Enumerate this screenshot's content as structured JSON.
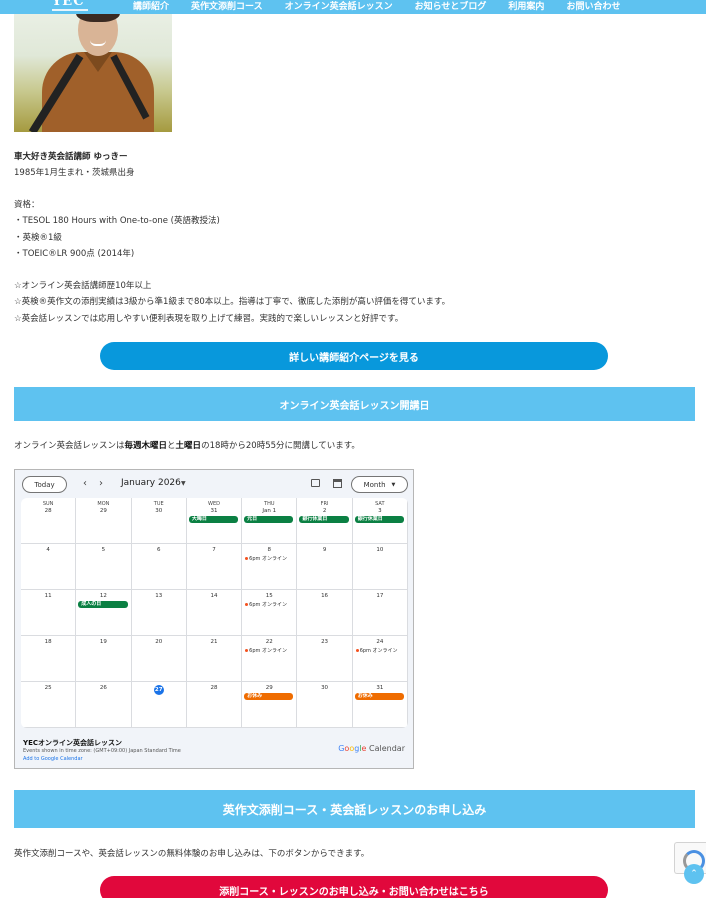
{
  "nav": {
    "logo": "YEC",
    "links": [
      "講師紹介",
      "英作文添削コース",
      "オンライン英会話レッスン",
      "お知らせとブログ",
      "利用案内",
      "お問い合わせ"
    ]
  },
  "bio": {
    "name": "車大好き英会話講師 ゆっきー",
    "birth": "1985年1月生まれ・茨城県出身",
    "qual_heading": "資格：",
    "quals": [
      "・TESOL 180 Hours with One-to-one (英語教授法)",
      "・英検®1級",
      "・TOEIC®LR 900点 (2014年)"
    ],
    "points": [
      "☆オンライン英会話講師歴10年以上",
      "☆英検®英作文の添削実績は3級から準1級まで80本以上。指導は丁寧で、徹底した添削が高い評価を得ています。",
      "☆英会話レッスンでは応用しやすい便利表現を取り上げて練習。実践的で楽しいレッスンと好評です。"
    ]
  },
  "buttons": {
    "profile": "詳しい講師紹介ページを見る",
    "apply": "添削コース・レッスンのお申し込み・お問い合わせはこちら"
  },
  "sections": {
    "schedule_title": "オンライン英会話レッスン開講日",
    "schedule_pre": "オンライン英会話レッスンは",
    "schedule_days1": "毎週木曜日",
    "schedule_mid": "と",
    "schedule_days2": "土曜日",
    "schedule_post": "の18時から20時55分に開講しています。",
    "apply_title": "英作文添削コース・英会話レッスンのお申し込み",
    "apply_text": "英作文添削コースや、英会話レッスンの無料体験のお申し込みは、下のボタンからできます。"
  },
  "calendar": {
    "today_label": "Today",
    "prev": "‹",
    "next": "›",
    "month_label": "January 2026",
    "view_label": "Month",
    "weekdays": [
      "SUN",
      "MON",
      "TUE",
      "WED",
      "THU",
      "FRI",
      "SAT"
    ],
    "weeks": [
      [
        {
          "d": "28"
        },
        {
          "d": "29"
        },
        {
          "d": "30"
        },
        {
          "d": "31",
          "chip": "大晦日",
          "color": "green"
        },
        {
          "d": "Jan 1",
          "chip": "元日",
          "color": "green"
        },
        {
          "d": "2",
          "chip": "銀行休業日",
          "color": "green"
        },
        {
          "d": "3",
          "chip": "銀行休業日",
          "color": "green"
        }
      ],
      [
        {
          "d": "4"
        },
        {
          "d": "5"
        },
        {
          "d": "6"
        },
        {
          "d": "7"
        },
        {
          "d": "8",
          "evt": "6pm オンライン"
        },
        {
          "d": "9"
        },
        {
          "d": "10"
        }
      ],
      [
        {
          "d": "11"
        },
        {
          "d": "12",
          "chip": "成人の日",
          "color": "green"
        },
        {
          "d": "13"
        },
        {
          "d": "14"
        },
        {
          "d": "15",
          "evt": "6pm オンライン"
        },
        {
          "d": "16"
        },
        {
          "d": "17"
        }
      ],
      [
        {
          "d": "18"
        },
        {
          "d": "19"
        },
        {
          "d": "20"
        },
        {
          "d": "21"
        },
        {
          "d": "22",
          "evt": "6pm オンライン"
        },
        {
          "d": "23"
        },
        {
          "d": "24",
          "evt": "6pm オンライン"
        }
      ],
      [
        {
          "d": "25"
        },
        {
          "d": "26"
        },
        {
          "d": "27",
          "today": true
        },
        {
          "d": "28"
        },
        {
          "d": "29",
          "chip": "お休み",
          "color": "orange"
        },
        {
          "d": "30"
        },
        {
          "d": "31",
          "chip": "お休み",
          "color": "orange"
        }
      ]
    ],
    "footer_title": "YECオンライン英会話レッスン",
    "footer_tz": "Events shown in time zone: (GMT+09:00) Japan Standard Time",
    "footer_link": "Add to Google Calendar",
    "brand_google": "Google",
    "brand_calendar": "Calendar"
  },
  "colors": {
    "accent": "#5ec2f0",
    "button_blue": "#0898dc",
    "button_red": "#e1083c",
    "chip_green": "#0b8043",
    "chip_orange": "#ef6c00"
  },
  "icons": {
    "scroll_top": "chevron-up-icon",
    "recaptcha": "recaptcha-icon"
  }
}
